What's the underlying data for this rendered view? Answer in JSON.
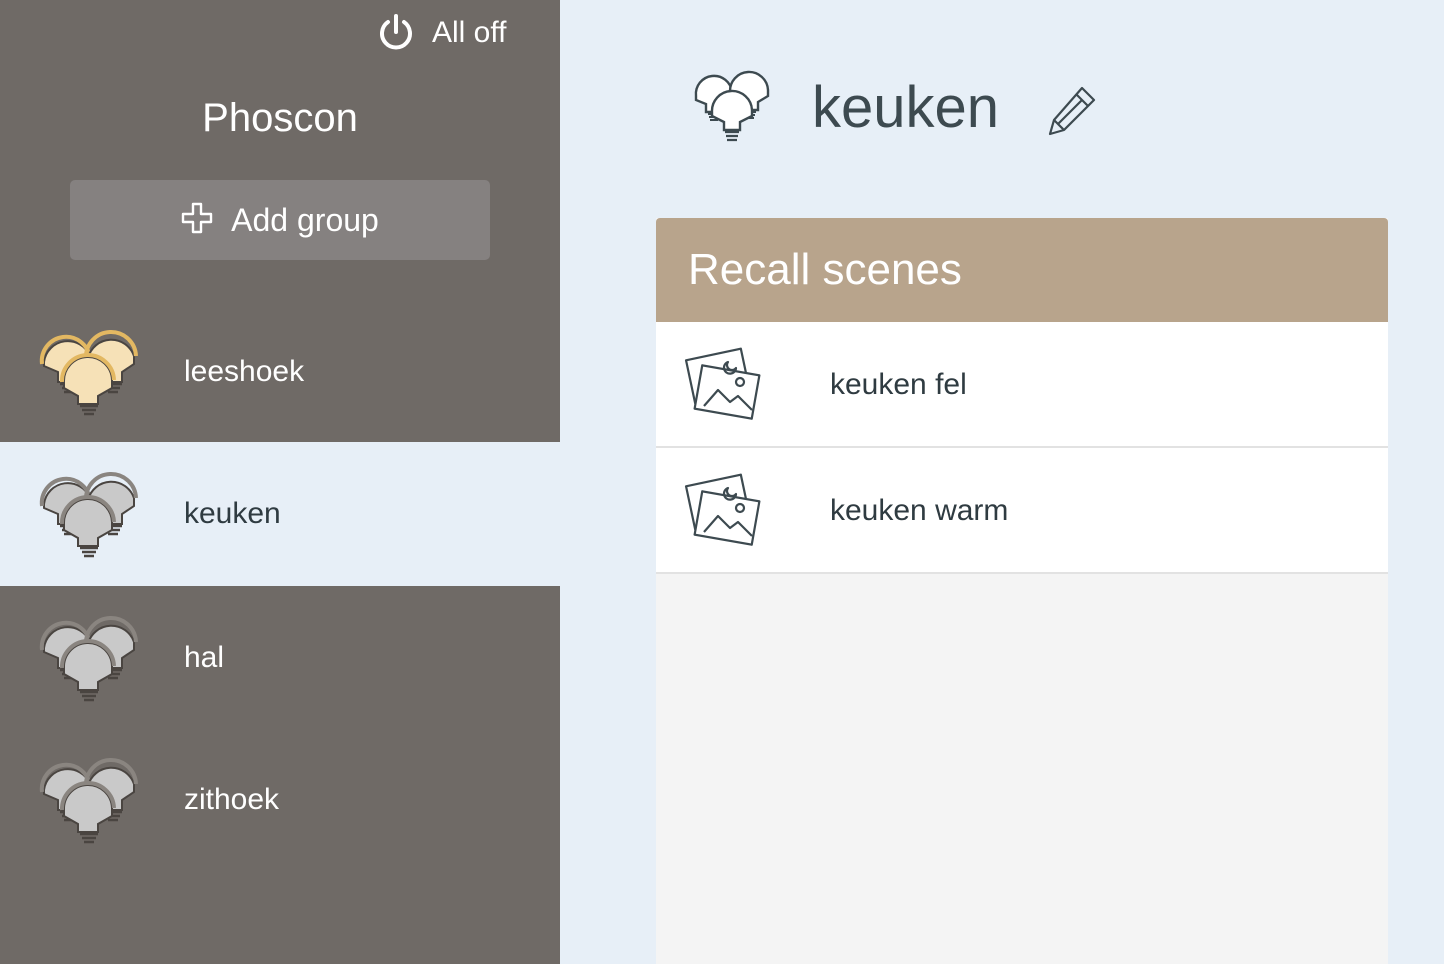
{
  "sidebar": {
    "all_off_label": "All off",
    "brand": "Phoscon",
    "add_group_label": "Add group",
    "groups": [
      {
        "label": "leeshoek",
        "state": "on",
        "active": false
      },
      {
        "label": "keuken",
        "state": "off",
        "active": true
      },
      {
        "label": "hal",
        "state": "off",
        "active": false
      },
      {
        "label": "zithoek",
        "state": "off",
        "active": false
      }
    ]
  },
  "main": {
    "title": "keuken",
    "scenes": {
      "header": "Recall scenes",
      "items": [
        {
          "label": "keuken fel"
        },
        {
          "label": "keuken warm"
        }
      ]
    }
  },
  "icons": {
    "all_off": "power-icon",
    "add_group": "plus-icon",
    "group": "bulbs-icon",
    "edit": "pencil-icon",
    "scene": "scene-pictures-icon"
  },
  "colors": {
    "sidebar_bg": "#6f6a66",
    "main_bg": "#e7eff7",
    "add_group_bg": "#858180",
    "scenes_header_bg": "#b8a48c",
    "bulb_on": "#f6e1b7",
    "bulb_on_outline": "#e3b862",
    "bulb_off": "#c9c9c9",
    "text_dark": "#2f3b41"
  }
}
